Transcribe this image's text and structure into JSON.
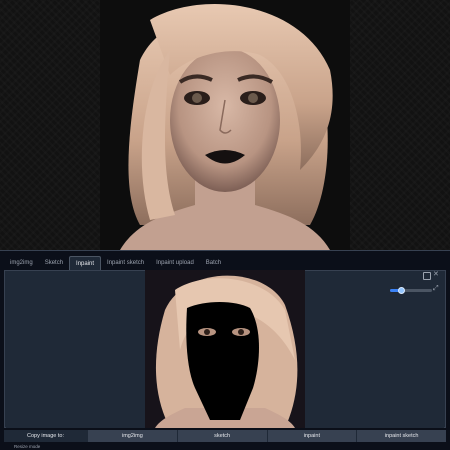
{
  "tabs": [
    {
      "label": "img2img"
    },
    {
      "label": "Sketch"
    },
    {
      "label": "Inpaint",
      "active": true
    },
    {
      "label": "Inpaint sketch"
    },
    {
      "label": "Inpaint upload"
    },
    {
      "label": "Batch"
    }
  ],
  "copy_bar": {
    "label": "Copy image to:",
    "buttons": [
      "img2img",
      "sketch",
      "inpaint",
      "inpaint sketch"
    ]
  },
  "resize_label": "Resize mode",
  "brush_size_fraction": 0.25,
  "icons": {
    "undo": "undo-icon",
    "close": "close-icon",
    "brush": "brush-icon"
  },
  "colors": {
    "accent": "#3b82f6",
    "panel": "#1f2937",
    "background": "#0b0f19",
    "mask": "#000000"
  }
}
